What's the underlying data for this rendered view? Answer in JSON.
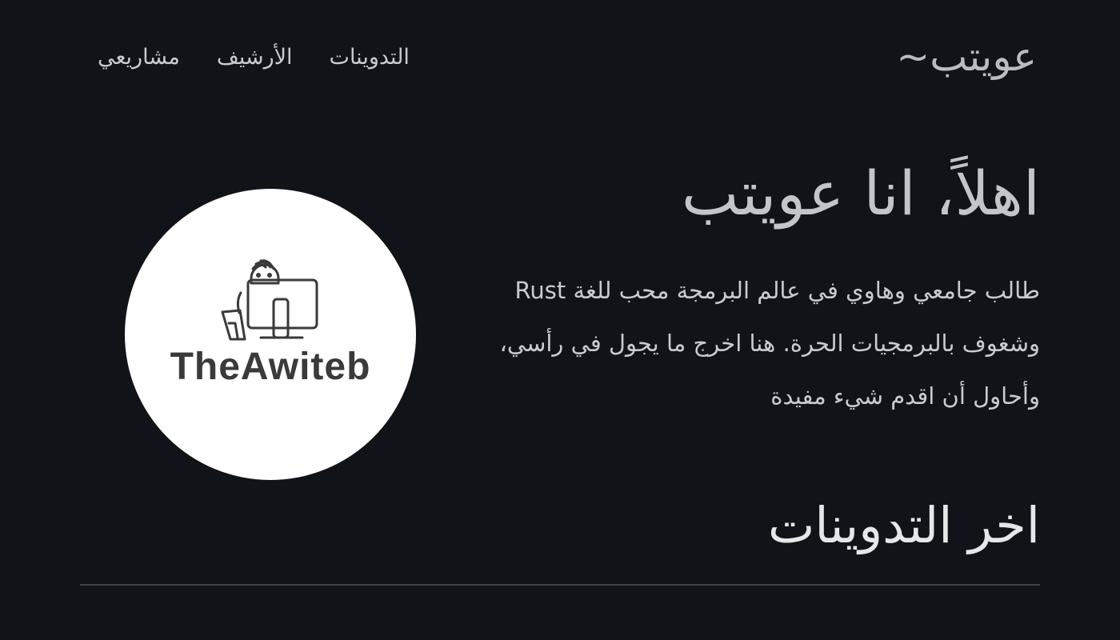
{
  "site": {
    "brand": "~عويتب",
    "nav": [
      {
        "label": "التدوينات"
      },
      {
        "label": "الأرشيف"
      },
      {
        "label": "مشاريعي"
      }
    ]
  },
  "hero": {
    "title": "اهلاً، انا عويتب",
    "bio": "طالب جامعي وهاوي في عالم البرمجة محب للغة Rust وشغوف بالبرمجيات الحرة. هنا اخرج ما يجول في رأسي، وأحاول أن اقدم شيء مفيدة",
    "avatar": {
      "logo_text": "TheAwiteb",
      "icon": "developer-at-computer-icon"
    }
  },
  "latest_posts": {
    "title": "اخر التدوينات"
  },
  "colors": {
    "background": "#101317",
    "text": "#c9cbcf",
    "heading": "#e6e7e9",
    "divider": "#3d4147",
    "avatar_bg": "#ffffff"
  }
}
